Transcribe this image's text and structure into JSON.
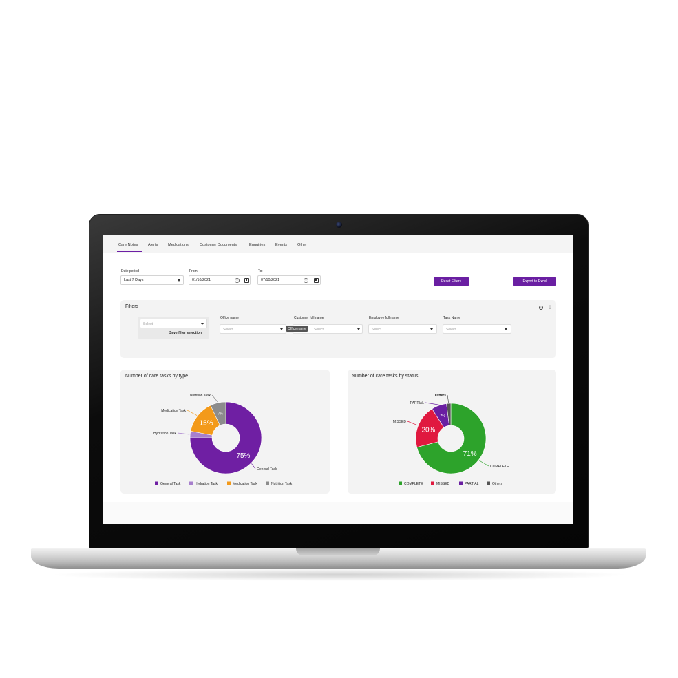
{
  "tabs": [
    {
      "label": "Care Notes",
      "active": true
    },
    {
      "label": "Alerts"
    },
    {
      "label": "Medications"
    },
    {
      "label": "Customer Documents"
    },
    {
      "label": "Enquiries"
    },
    {
      "label": "Events"
    },
    {
      "label": "Other"
    }
  ],
  "date_period": {
    "label": "Date period",
    "value": "Last 7 Days"
  },
  "from": {
    "label": "From:",
    "value": "01/10/2021"
  },
  "to": {
    "label": "To:",
    "value": "07/10/2021"
  },
  "buttons": {
    "reset": "Reset Filters",
    "export": "Export to Excel"
  },
  "filters": {
    "title": "Filters",
    "saved_select_placeholder": "Select",
    "save_selection": "Save filter selection",
    "fields": [
      {
        "label": "Office name",
        "placeholder": "Select"
      },
      {
        "label": "Customer full name",
        "placeholder": "Select"
      },
      {
        "label": "Employee full name",
        "placeholder": "Select"
      },
      {
        "label": "Task Name",
        "placeholder": "Select"
      }
    ],
    "tooltip": "Office name"
  },
  "colors": {
    "accent": "#6a1fa2",
    "general": "#6f1fa3",
    "hydration": "#a77fcd",
    "medication": "#f39a1a",
    "nutrition": "#8c8c8c",
    "complete": "#2da32b",
    "missed": "#e0193f",
    "partial": "#6a1fa2",
    "others": "#555555"
  },
  "chart_data": [
    {
      "type": "pie",
      "title": "Number of care tasks by type",
      "slices": [
        {
          "name": "General Task",
          "value": 75,
          "label": "75%"
        },
        {
          "name": "Hydration Task",
          "value": 3,
          "label": ""
        },
        {
          "name": "Medication Task",
          "value": 15,
          "label": "15%"
        },
        {
          "name": "Nutrition Task",
          "value": 7,
          "label": "7%"
        }
      ],
      "legend": [
        "General Task",
        "Hydration Task",
        "Medication Task",
        "Nutrition Task"
      ],
      "legend_position": "bottom"
    },
    {
      "type": "pie",
      "title": "Number of care tasks by status",
      "slices": [
        {
          "name": "COMPLETE",
          "value": 71,
          "label": "71%"
        },
        {
          "name": "MISSED",
          "value": 20,
          "label": "20%"
        },
        {
          "name": "PARTIAL",
          "value": 7,
          "label": "7%"
        },
        {
          "name": "Others",
          "value": 2,
          "label": ""
        }
      ],
      "legend": [
        "COMPLETE",
        "MISSED",
        "PARTIAL",
        "Others"
      ],
      "legend_position": "bottom"
    }
  ]
}
